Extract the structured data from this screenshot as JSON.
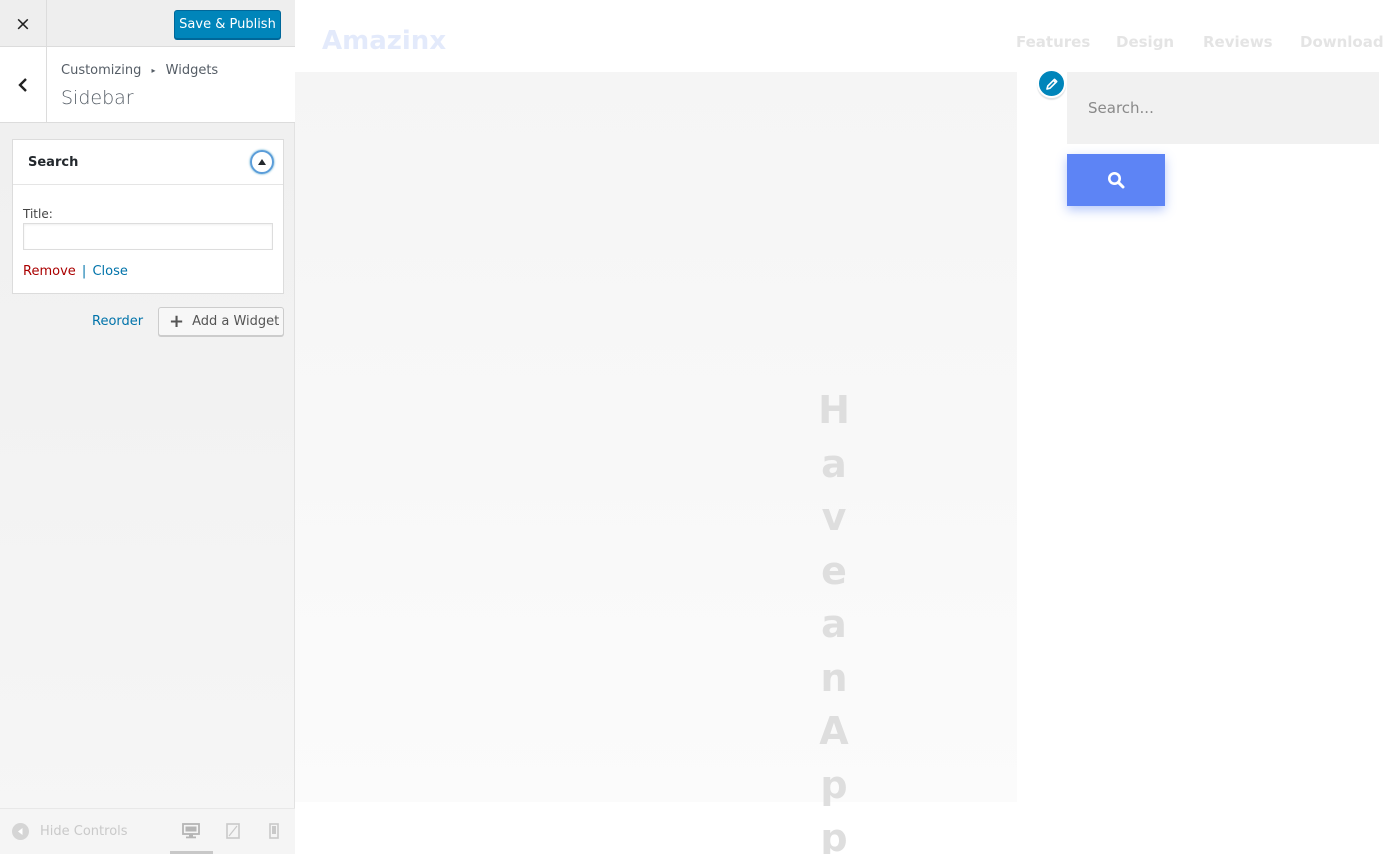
{
  "customizer": {
    "close_label": "×",
    "save_label": "Save & Publish",
    "breadcrumb": {
      "root": "Customizing",
      "separator": "▸",
      "current": "Widgets"
    },
    "section_title": "Sidebar",
    "widget": {
      "title": "Search",
      "title_field_label": "Title:",
      "title_field_value": "",
      "remove_label": "Remove",
      "separator": "|",
      "close_label": "Close"
    },
    "reorder_label": "Reorder",
    "add_widget_label": "Add a Widget",
    "footer": {
      "hide_controls_label": "Hide Controls"
    }
  },
  "preview": {
    "logo": "Amazinx",
    "nav": [
      "Features",
      "Design",
      "Reviews",
      "Download"
    ],
    "hero_letters": [
      "H",
      "a",
      "v",
      "e",
      "a",
      "n",
      "A",
      "p",
      "p"
    ],
    "search": {
      "placeholder": "Search..."
    }
  },
  "colors": {
    "primary_button": "#0085ba",
    "remove_link": "#aa0000",
    "link": "#0073aa",
    "search_button": "#5d84f5"
  },
  "icons": {
    "close": "close-icon",
    "back": "chevron-left-icon",
    "toggle": "arrow-up-icon",
    "add": "plus-icon",
    "hide": "arrow-left-circle-icon",
    "devices": [
      "desktop-icon",
      "tablet-icon",
      "mobile-icon"
    ],
    "edit": "pencil-icon",
    "search": "search-icon"
  }
}
